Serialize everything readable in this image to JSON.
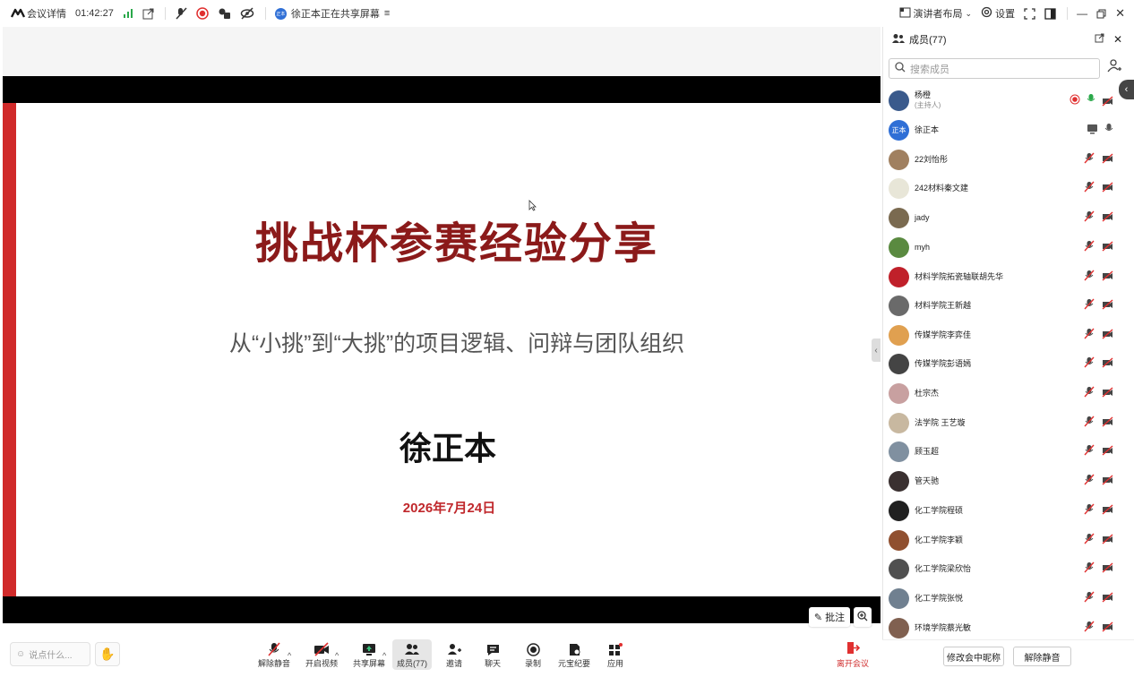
{
  "topbar": {
    "meeting_details": "会议详情",
    "timer": "01:42:27",
    "sharing_status": "徐正本正在共享屏幕",
    "sharer_avatar_text": "正本",
    "layout_label": "演讲者布局",
    "settings_label": "设置"
  },
  "slide": {
    "title": "挑战杯参赛经验分享",
    "subtitle": "从“小挑”到“大挑”的项目逻辑、问辩与团队组织",
    "presenter": "徐正本",
    "date": "2026年7月24日"
  },
  "stage_tools": {
    "annotate_label": "批注"
  },
  "bottombar": {
    "chat_placeholder": "说点什么...",
    "tools": [
      {
        "label": "解除静音",
        "icon": "mic-muted-icon"
      },
      {
        "label": "开启视频",
        "icon": "video-off-icon"
      },
      {
        "label": "共享屏幕",
        "icon": "share-screen-icon"
      },
      {
        "label": "成员(77)",
        "icon": "members-icon"
      },
      {
        "label": "邀请",
        "icon": "invite-icon"
      },
      {
        "label": "聊天",
        "icon": "chat-icon"
      },
      {
        "label": "录制",
        "icon": "record-icon"
      },
      {
        "label": "元宝纪要",
        "icon": "notes-icon"
      },
      {
        "label": "应用",
        "icon": "apps-icon"
      }
    ],
    "leave_label": "离开会议"
  },
  "panel": {
    "title": "成员(77)",
    "search_placeholder": "搜索成员",
    "members": [
      {
        "name": "杨橙",
        "role": "(主持人)",
        "avatar_color": "#3a5a8c",
        "avatar_text": ""
      },
      {
        "name": "徐正本",
        "role": "",
        "avatar_color": "#2f6fd6",
        "avatar_text": "正本"
      },
      {
        "name": "22刘怡彤",
        "role": "",
        "avatar_color": "#a08060",
        "avatar_text": ""
      },
      {
        "name": "242材料秦文建",
        "role": "",
        "avatar_color": "#e8e6d8",
        "avatar_text": ""
      },
      {
        "name": "jady",
        "role": "",
        "avatar_color": "#7a6a50",
        "avatar_text": ""
      },
      {
        "name": "myh",
        "role": "",
        "avatar_color": "#5a8a40",
        "avatar_text": ""
      },
      {
        "name": "材料学院拓瓷轴联胡先华",
        "role": "",
        "avatar_color": "#c0202a",
        "avatar_text": ""
      },
      {
        "name": "材料学院王新越",
        "role": "",
        "avatar_color": "#6a6a6a",
        "avatar_text": ""
      },
      {
        "name": "传媒学院李弈佳",
        "role": "",
        "avatar_color": "#e0a050",
        "avatar_text": ""
      },
      {
        "name": "传媒学院彭语嫣",
        "role": "",
        "avatar_color": "#444444",
        "avatar_text": ""
      },
      {
        "name": "杜宗杰",
        "role": "",
        "avatar_color": "#c8a0a0",
        "avatar_text": ""
      },
      {
        "name": "法学院 王艺璇",
        "role": "",
        "avatar_color": "#c8b8a0",
        "avatar_text": ""
      },
      {
        "name": "顾玉超",
        "role": "",
        "avatar_color": "#8090a0",
        "avatar_text": ""
      },
      {
        "name": "管天驰",
        "role": "",
        "avatar_color": "#3a3030",
        "avatar_text": ""
      },
      {
        "name": "化工学院程硕",
        "role": "",
        "avatar_color": "#202020",
        "avatar_text": ""
      },
      {
        "name": "化工学院李颖",
        "role": "",
        "avatar_color": "#905030",
        "avatar_text": ""
      },
      {
        "name": "化工学院梁欣怡",
        "role": "",
        "avatar_color": "#505050",
        "avatar_text": ""
      },
      {
        "name": "化工学院张悦",
        "role": "",
        "avatar_color": "#708090",
        "avatar_text": ""
      },
      {
        "name": "环境学院蔡光敏",
        "role": "",
        "avatar_color": "#806050",
        "avatar_text": ""
      }
    ],
    "rename_button": "修改会中昵称",
    "unmute_button": "解除静音"
  }
}
